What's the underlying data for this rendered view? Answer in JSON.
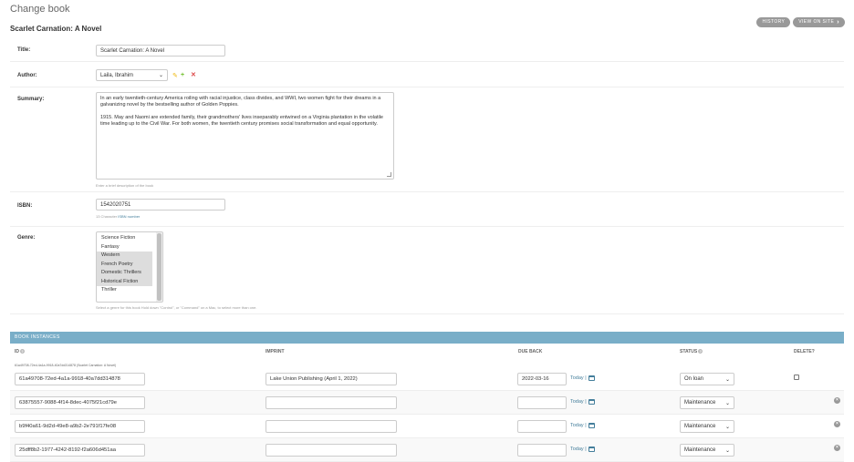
{
  "page": {
    "title": "Change book",
    "object_title": "Scarlet Carnation: A Novel"
  },
  "tools": {
    "history": "HISTORY",
    "view_on_site": "VIEW ON SITE"
  },
  "fields": {
    "title": {
      "label": "Title:",
      "value": "Scarlet Carnation: A Novel"
    },
    "author": {
      "label": "Author:",
      "value": "Laila, Ibrahim",
      "edit_icon": "pencil-icon",
      "add_icon": "plus-icon",
      "delete_icon": "x-icon"
    },
    "summary": {
      "label": "Summary:",
      "paragraphs": [
        "In an early twentieth-century America roiling with racial injustice, class divides, and WWI, two women fight for their dreams in a galvanizing novel by the bestselling author of Golden Poppies.",
        "1915. May and Naomi are extended family, their grandmothers' lives inseparably entwined on a Virginia plantation in the volatile time leading up to the Civil War. For both women, the twentieth century promises social transformation and equal opportunity."
      ],
      "help": "Enter a brief description of the book"
    },
    "isbn": {
      "label": "ISBN:",
      "value": "1542020751",
      "help_prefix": "13 Character ",
      "help_link": "ISBN number"
    },
    "genre": {
      "label": "Genre:",
      "options": [
        {
          "label": "Science Fiction",
          "selected": false
        },
        {
          "label": "Fantasy",
          "selected": false
        },
        {
          "label": "Western",
          "selected": true
        },
        {
          "label": "French Poetry",
          "selected": true
        },
        {
          "label": "Domestic Thrillers",
          "selected": true
        },
        {
          "label": "Historical Fiction",
          "selected": true
        },
        {
          "label": "Thriller",
          "selected": false
        }
      ],
      "help": "Select a genre for this book Hold down \"Control\", or \"Command\" on a Mac, to select more than one."
    }
  },
  "instances": {
    "header": "BOOK INSTANCES",
    "columns": {
      "id": "ID",
      "imprint": "IMPRINT",
      "due_back": "DUE BACK",
      "status": "STATUS",
      "delete": "DELETE?"
    },
    "original_text": "61a49708-72ed-4a1a-9918-40a7dd314878 (Scarlet Carnation: A Novel)",
    "today_label": "Today |",
    "rows": [
      {
        "id": "61a49708-72ed-4a1a-9918-40a7dd314878",
        "imprint": "Lake Union Publishing (April 1, 2022)",
        "due_back": "2022-03-16",
        "status": "On loan"
      },
      {
        "id": "63875557-9088-4f14-8dec-4075f21cd79e",
        "imprint": "",
        "due_back": "",
        "status": "Maintenance"
      },
      {
        "id": "b9f40a61-9d2d-49e8-a9b2-2e791f17fe08",
        "imprint": "",
        "due_back": "",
        "status": "Maintenance"
      },
      {
        "id": "25dff8b2-1977-4242-8192-f2a606d451aa",
        "imprint": "",
        "due_back": "",
        "status": "Maintenance"
      }
    ]
  }
}
